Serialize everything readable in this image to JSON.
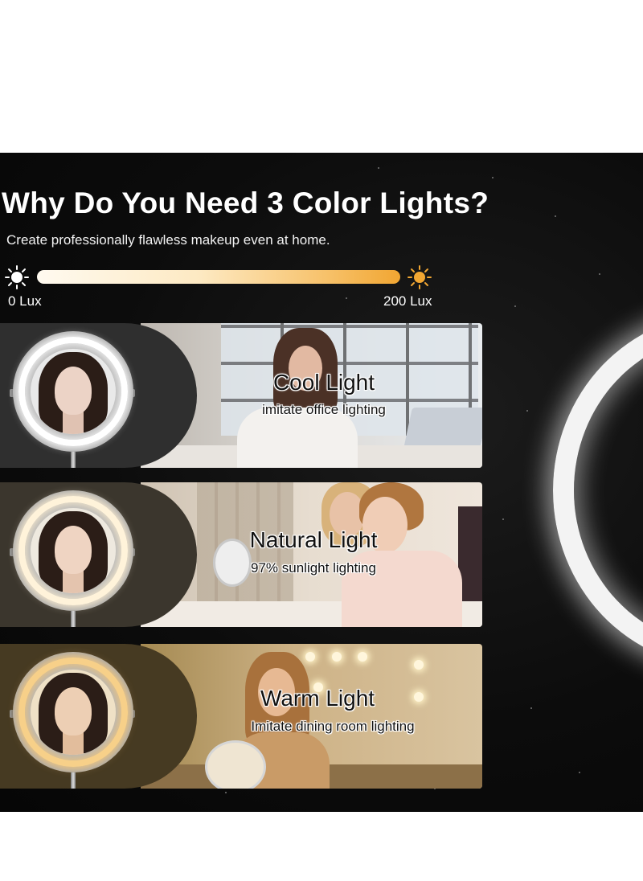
{
  "banner": {
    "title": "Why Do You Need 3 Color Lights?",
    "subtitle": "Create professionally flawless makeup even at home.",
    "lux_scale": {
      "min_label": "0 Lux",
      "max_label": "200 Lux",
      "min_icon": "sun-white-icon",
      "max_icon": "sun-orange-icon"
    }
  },
  "panels": [
    {
      "title": "Cool Light",
      "description": "imitate office lighting",
      "tone": "#f4f4f4"
    },
    {
      "title": "Natural Light",
      "description": "97% sunlight lighting",
      "tone": "#fff3da"
    },
    {
      "title": "Warm Light",
      "description": "Imitate dining room lighting",
      "tone": "#f7d089"
    }
  ],
  "colors": {
    "background": "#0a0a0a",
    "cool": "#f4f4f4",
    "natural": "#fff3da",
    "warm": "#f7d089",
    "accent_orange": "#f1a632"
  }
}
